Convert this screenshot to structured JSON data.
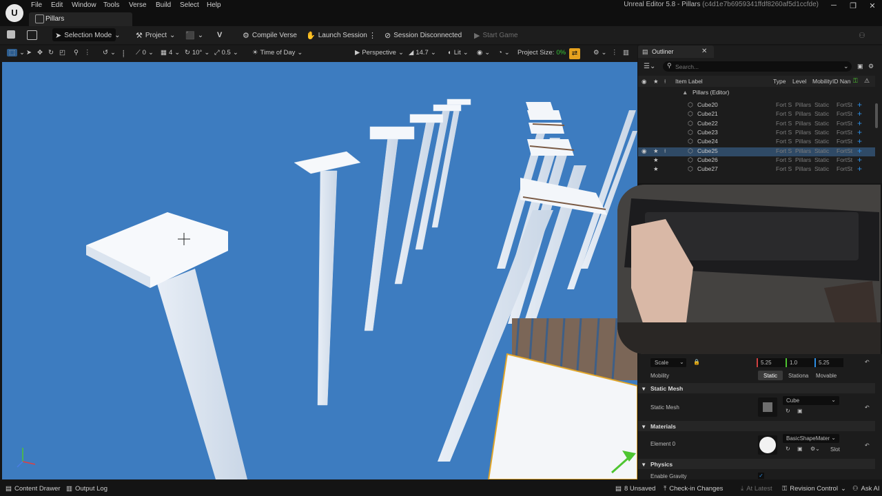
{
  "menu": {
    "items": [
      "File",
      "Edit",
      "Window",
      "Tools",
      "Verse",
      "Build",
      "Select",
      "Help"
    ],
    "doc_tab": "Pillars",
    "app_title": "Unreal Editor 5.8 - Pillars",
    "app_title_hash": "(c4d1e7b6959341ffdf8260af5d1ccfde)"
  },
  "toolbar": {
    "selection_mode": "Selection Mode",
    "project": "Project",
    "compile_verse": "Compile Verse",
    "launch_session": "Launch Session",
    "session_status": "Session Disconnected",
    "start_game": "Start Game"
  },
  "viewport_toolbar": {
    "rotate_snap_value": "0",
    "grid_value": "4",
    "angle_value": "10°",
    "scale_value": "0.5",
    "time_of_day": "Time of Day",
    "perspective": "Perspective",
    "fov": "14.7",
    "lit": "Lit",
    "project_size_label": "Project Size:",
    "project_size_value": "0%"
  },
  "outliner": {
    "title": "Outliner",
    "search_placeholder": "Search...",
    "columns": [
      "Item Label",
      "Type",
      "Level",
      "Mobility",
      "ID Nan"
    ],
    "group_label": "Pillars (Editor)",
    "rows": [
      {
        "name": "Cube20",
        "type": "Fort S",
        "level": "Pillars",
        "mobility": "Static",
        "id": "FortSt",
        "selected": false
      },
      {
        "name": "Cube21",
        "type": "Fort S",
        "level": "Pillars",
        "mobility": "Static",
        "id": "FortSt",
        "selected": false
      },
      {
        "name": "Cube22",
        "type": "Fort S",
        "level": "Pillars",
        "mobility": "Static",
        "id": "FortSt",
        "selected": false
      },
      {
        "name": "Cube23",
        "type": "Fort S",
        "level": "Pillars",
        "mobility": "Static",
        "id": "FortSt",
        "selected": false
      },
      {
        "name": "Cube24",
        "type": "Fort S",
        "level": "Pillars",
        "mobility": "Static",
        "id": "FortSt",
        "selected": false
      },
      {
        "name": "Cube25",
        "type": "Fort S",
        "level": "Pillars",
        "mobility": "Static",
        "id": "FortSt",
        "selected": true
      },
      {
        "name": "Cube26",
        "type": "Fort S",
        "level": "Pillars",
        "mobility": "Static",
        "id": "FortSt",
        "selected": false
      },
      {
        "name": "Cube27",
        "type": "Fort S",
        "level": "Pillars",
        "mobility": "Static",
        "id": "FortSt",
        "selected": false
      }
    ]
  },
  "details": {
    "scale_label": "Scale",
    "scale_x": "5.25",
    "scale_y": "1.0",
    "scale_z": "5.25",
    "mobility_label": "Mobility",
    "mobility_options": [
      "Static",
      "Stationa",
      "Movable"
    ],
    "mobility_selected": "Static",
    "static_mesh_section": "Static Mesh",
    "static_mesh_label": "Static Mesh",
    "static_mesh_value": "Cube",
    "materials_section": "Materials",
    "element0_label": "Element 0",
    "material_value": "BasicShapeMater",
    "slot_label": "Slot",
    "physics_section": "Physics",
    "enable_gravity_label": "Enable Gravity",
    "enable_gravity": true
  },
  "statusbar": {
    "content_drawer": "Content Drawer",
    "output_log": "Output Log",
    "unsaved": "8 Unsaved",
    "check_in": "Check-in Changes",
    "at_latest": "At Latest",
    "revision_control": "Revision Control",
    "ask_ai": "Ask AI"
  },
  "colors": {
    "viewport_sky": "#3d7cc0",
    "accent_blue": "#2d8fe6",
    "selected_row": "#2f4a66",
    "project_size": "#37c837",
    "warning_orange": "#e6a21e"
  }
}
